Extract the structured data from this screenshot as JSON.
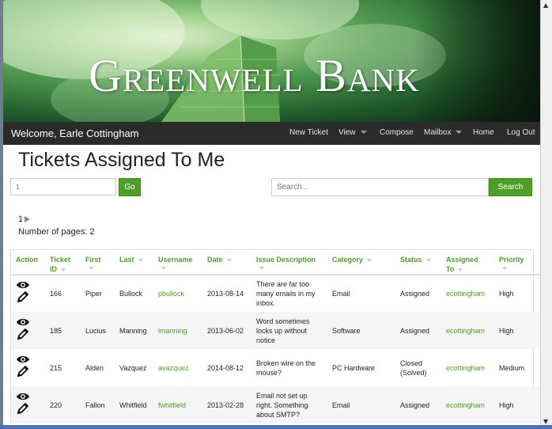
{
  "brand": "Greenwell Bank",
  "navbar": {
    "welcome": "Welcome, Earle Cottingham",
    "items": [
      "New Ticket",
      "View",
      "Compose",
      "Mailbox",
      "Home",
      "Log Out"
    ]
  },
  "page": {
    "title": "Tickets Assigned To Me",
    "page_input_value": "1",
    "go_label": "Go",
    "search_placeholder": "Search...",
    "search_label": "Search",
    "current_page": "1",
    "page_count_text": "Number of pages: 2"
  },
  "table": {
    "headers": {
      "action": "Action",
      "ticket_id": [
        "Ticket",
        "ID"
      ],
      "first": "First",
      "last": "Last",
      "username": "Username",
      "date": "Date",
      "issue": "Issue Description",
      "category": "Category",
      "status": "Status",
      "assigned": [
        "Assigned",
        "To"
      ],
      "priority": "Priority"
    },
    "rows": [
      {
        "id": "166",
        "first": "Piper",
        "last": "Bullock",
        "username": "pbullock",
        "date": "2013-08-14",
        "issue": [
          "There are far too",
          "many emails in my",
          "inbox."
        ],
        "category": "Email",
        "status": [
          "Assigned"
        ],
        "assigned": "ecottingham",
        "priority": "High"
      },
      {
        "id": "185",
        "first": "Lucius",
        "last": "Manning",
        "username": "lmanning",
        "date": "2013-06-02",
        "issue": [
          "Word sometimes",
          "locks up without",
          "notice"
        ],
        "category": "Software",
        "status": [
          "Assigned"
        ],
        "assigned": "ecottingham",
        "priority": "High"
      },
      {
        "id": "215",
        "first": "Alden",
        "last": "Vazquez",
        "username": "avazquez",
        "date": "2014-08-12",
        "issue": [
          "Broken wire on the",
          "mouse?"
        ],
        "category": "PC Hardware",
        "status": [
          "Closed",
          "(Solved)"
        ],
        "assigned": "ecottingham",
        "priority": "Medium"
      },
      {
        "id": "220",
        "first": "Fallon",
        "last": "Whitfield",
        "username": "fwhitfield",
        "date": "2013-02-28",
        "issue": [
          "Email not set up",
          "right. Something",
          "about SMTP?"
        ],
        "category": "Email",
        "status": [
          "Assigned"
        ],
        "assigned": "ecottingham",
        "priority": "High"
      }
    ]
  }
}
